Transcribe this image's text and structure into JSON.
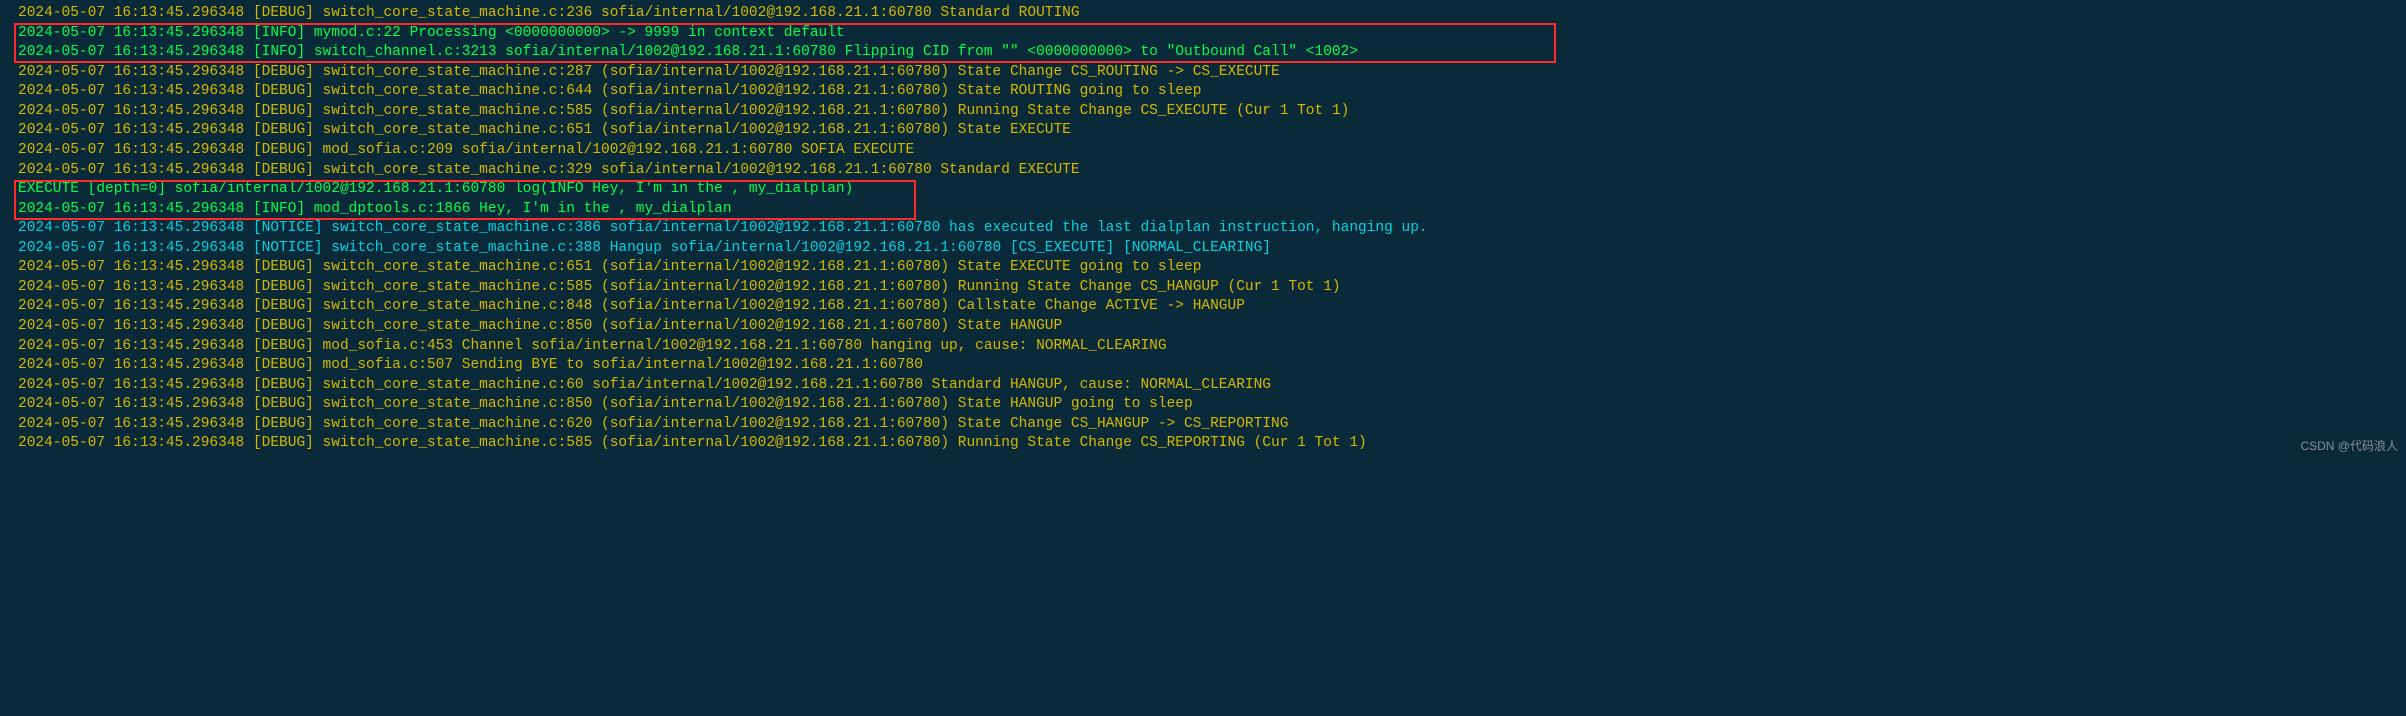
{
  "lines": [
    {
      "cls": "debug",
      "text": "2024-05-07 16:13:45.296348 [DEBUG] switch_core_state_machine.c:236 sofia/internal/1002@192.168.21.1:60780 Standard ROUTING"
    },
    {
      "cls": "info",
      "text": "2024-05-07 16:13:45.296348 [INFO] mymod.c:22 Processing  <0000000000> -> 9999 in context default"
    },
    {
      "cls": "info",
      "text": "2024-05-07 16:13:45.296348 [INFO] switch_channel.c:3213 sofia/internal/1002@192.168.21.1:60780 Flipping CID from \"\" <0000000000> to \"Outbound Call\" <1002>"
    },
    {
      "cls": "debug",
      "text": "2024-05-07 16:13:45.296348 [DEBUG] switch_core_state_machine.c:287 (sofia/internal/1002@192.168.21.1:60780) State Change CS_ROUTING -> CS_EXECUTE"
    },
    {
      "cls": "debug",
      "text": "2024-05-07 16:13:45.296348 [DEBUG] switch_core_state_machine.c:644 (sofia/internal/1002@192.168.21.1:60780) State ROUTING going to sleep"
    },
    {
      "cls": "debug",
      "text": "2024-05-07 16:13:45.296348 [DEBUG] switch_core_state_machine.c:585 (sofia/internal/1002@192.168.21.1:60780) Running State Change CS_EXECUTE (Cur 1 Tot 1)"
    },
    {
      "cls": "debug",
      "text": "2024-05-07 16:13:45.296348 [DEBUG] switch_core_state_machine.c:651 (sofia/internal/1002@192.168.21.1:60780) State EXECUTE"
    },
    {
      "cls": "debug",
      "text": "2024-05-07 16:13:45.296348 [DEBUG] mod_sofia.c:209 sofia/internal/1002@192.168.21.1:60780 SOFIA EXECUTE"
    },
    {
      "cls": "debug",
      "text": "2024-05-07 16:13:45.296348 [DEBUG] switch_core_state_machine.c:329 sofia/internal/1002@192.168.21.1:60780 Standard EXECUTE"
    },
    {
      "cls": "exec",
      "text": "EXECUTE [depth=0] sofia/internal/1002@192.168.21.1:60780 log(INFO Hey, I'm in the , my_dialplan)"
    },
    {
      "cls": "info",
      "text": "2024-05-07 16:13:45.296348 [INFO] mod_dptools.c:1866 Hey, I'm in the , my_dialplan"
    },
    {
      "cls": "notice",
      "text": "2024-05-07 16:13:45.296348 [NOTICE] switch_core_state_machine.c:386 sofia/internal/1002@192.168.21.1:60780 has executed the last dialplan instruction, hanging up."
    },
    {
      "cls": "notice",
      "text": "2024-05-07 16:13:45.296348 [NOTICE] switch_core_state_machine.c:388 Hangup sofia/internal/1002@192.168.21.1:60780 [CS_EXECUTE] [NORMAL_CLEARING]"
    },
    {
      "cls": "debug",
      "text": "2024-05-07 16:13:45.296348 [DEBUG] switch_core_state_machine.c:651 (sofia/internal/1002@192.168.21.1:60780) State EXECUTE going to sleep"
    },
    {
      "cls": "debug",
      "text": "2024-05-07 16:13:45.296348 [DEBUG] switch_core_state_machine.c:585 (sofia/internal/1002@192.168.21.1:60780) Running State Change CS_HANGUP (Cur 1 Tot 1)"
    },
    {
      "cls": "debug",
      "text": "2024-05-07 16:13:45.296348 [DEBUG] switch_core_state_machine.c:848 (sofia/internal/1002@192.168.21.1:60780) Callstate Change ACTIVE -> HANGUP"
    },
    {
      "cls": "debug",
      "text": "2024-05-07 16:13:45.296348 [DEBUG] switch_core_state_machine.c:850 (sofia/internal/1002@192.168.21.1:60780) State HANGUP"
    },
    {
      "cls": "debug",
      "text": "2024-05-07 16:13:45.296348 [DEBUG] mod_sofia.c:453 Channel sofia/internal/1002@192.168.21.1:60780 hanging up, cause: NORMAL_CLEARING"
    },
    {
      "cls": "debug",
      "text": "2024-05-07 16:13:45.296348 [DEBUG] mod_sofia.c:507 Sending BYE to sofia/internal/1002@192.168.21.1:60780"
    },
    {
      "cls": "debug",
      "text": "2024-05-07 16:13:45.296348 [DEBUG] switch_core_state_machine.c:60 sofia/internal/1002@192.168.21.1:60780 Standard HANGUP, cause: NORMAL_CLEARING"
    },
    {
      "cls": "debug",
      "text": "2024-05-07 16:13:45.296348 [DEBUG] switch_core_state_machine.c:850 (sofia/internal/1002@192.168.21.1:60780) State HANGUP going to sleep"
    },
    {
      "cls": "debug",
      "text": "2024-05-07 16:13:45.296348 [DEBUG] switch_core_state_machine.c:620 (sofia/internal/1002@192.168.21.1:60780) State Change CS_HANGUP -> CS_REPORTING"
    },
    {
      "cls": "debug",
      "text": "2024-05-07 16:13:45.296348 [DEBUG] switch_core_state_machine.c:585 (sofia/internal/1002@192.168.21.1:60780) Running State Change CS_REPORTING (Cur 1 Tot 1)"
    }
  ],
  "watermark": "CSDN @代码浪人"
}
